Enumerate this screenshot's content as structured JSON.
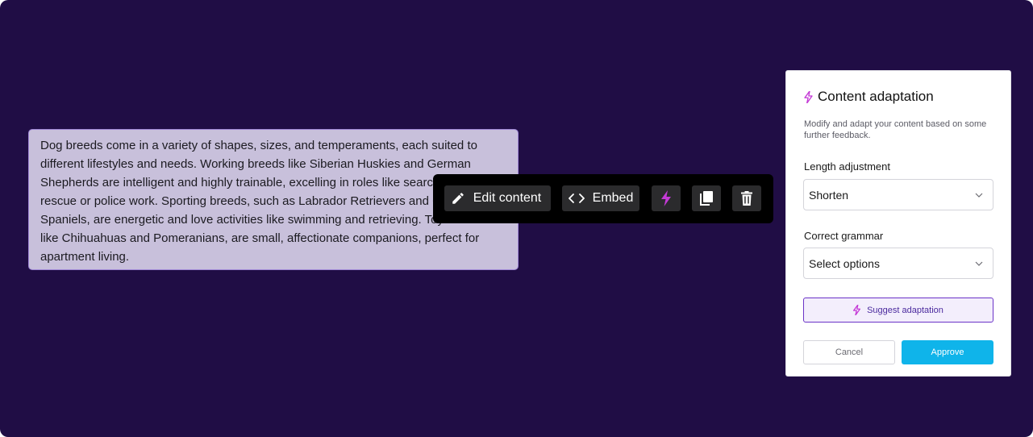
{
  "content": {
    "paragraph_lines": [
      "Dog breeds come in a variety of shapes, sizes, and temperaments, each suited to",
      "different lifestyles and needs. Working breeds like Siberian Huskies and German",
      "Shepherds are intelligent and highly trainable, excelling in roles like search and",
      "rescue or police work. Sporting breeds, such as Labrador Retrievers and Cocker",
      "Spaniels, are energetic and love activities like swimming and retrieving. Toy breeds",
      "like Chihuahuas and Pomeranians, are small, affectionate companions, perfect for",
      "apartment living."
    ]
  },
  "toolbar": {
    "edit_label": "Edit content",
    "edit_icon": "pencil-icon",
    "embed_label": "Embed",
    "embed_icon": "code-icon",
    "ai_icon": "lightning-icon",
    "copy_icon": "copy-icon",
    "delete_icon": "trash-icon"
  },
  "panel": {
    "title": "Content adaptation",
    "title_icon": "lightning-icon",
    "description": "Modify and adapt your content based on some further feedback.",
    "length_label": "Length adjustment",
    "length_value": "Shorten",
    "grammar_label": "Correct grammar",
    "grammar_placeholder": "Select options",
    "suggest_label": "Suggest adaptation",
    "cancel_label": "Cancel",
    "approve_label": "Approve"
  },
  "colors": {
    "background": "#200d45",
    "highlight": "#c8c0db",
    "accent_purple": "#6b33c7",
    "accent_magenta": "#c43ad6",
    "approve": "#0fb4ea"
  }
}
